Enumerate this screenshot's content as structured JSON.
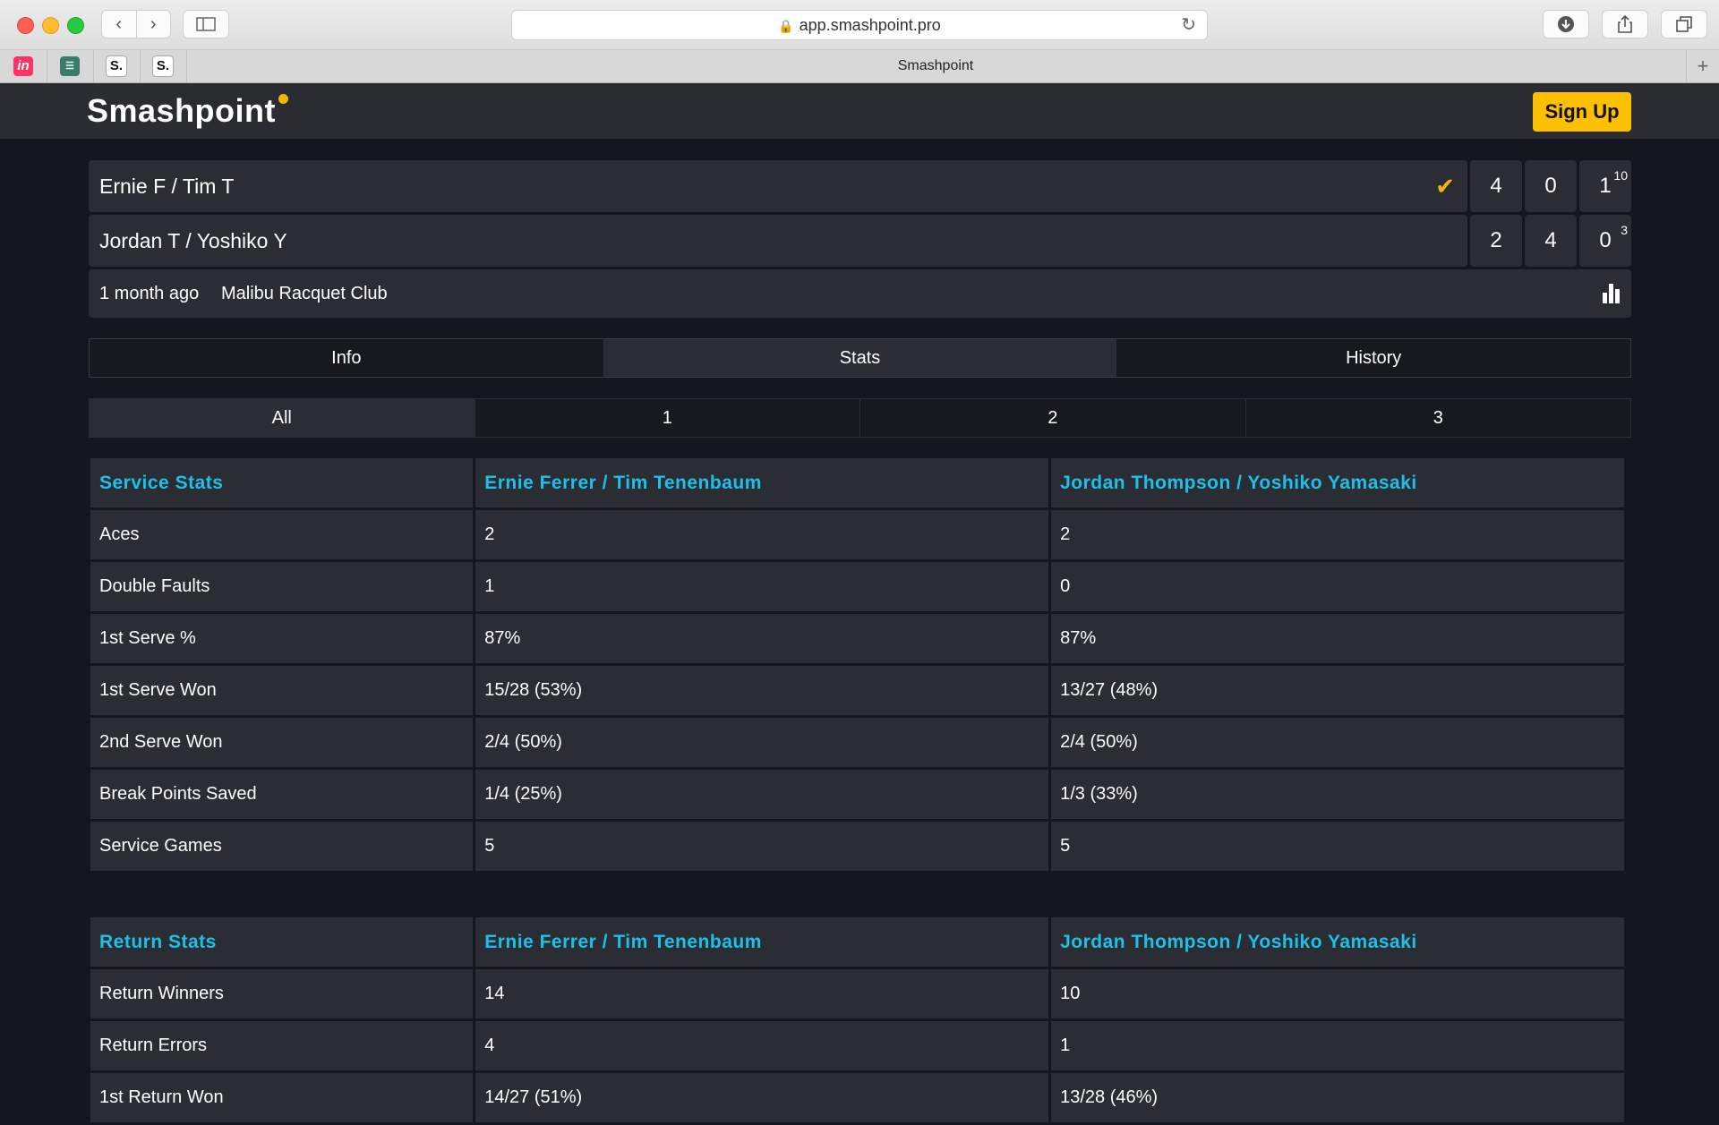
{
  "browser": {
    "url": "app.smashpoint.pro",
    "tab_title": "Smashpoint",
    "favicons": [
      "invision-icon",
      "bookmark-icon",
      "s-icon",
      "s-icon"
    ],
    "fav_letters": [
      "in",
      "",
      "S.",
      "S."
    ]
  },
  "header": {
    "logo": "Smashpoint",
    "signup_label": "Sign Up"
  },
  "match": {
    "team1": {
      "name": "Ernie F / Tim T",
      "winner": true,
      "sets": [
        "4",
        "0",
        "1"
      ],
      "tiebreak": "10"
    },
    "team2": {
      "name": "Jordan T / Yoshiko Y",
      "sets": [
        "2",
        "4",
        "0"
      ],
      "tiebreak": "3"
    },
    "time": "1 month ago",
    "venue": "Malibu Racquet Club"
  },
  "tabs": {
    "main": [
      "Info",
      "Stats",
      "History"
    ],
    "active_main": "Stats",
    "sets": [
      "All",
      "1",
      "2",
      "3"
    ],
    "active_set": "All"
  },
  "service_stats": {
    "headers": [
      "Service Stats",
      "Ernie Ferrer / Tim Tenenbaum",
      "Jordan Thompson / Yoshiko Yamasaki"
    ],
    "rows": [
      [
        "Aces",
        "2",
        "2"
      ],
      [
        "Double Faults",
        "1",
        "0"
      ],
      [
        "1st Serve %",
        "87%",
        "87%"
      ],
      [
        "1st Serve Won",
        "15/28 (53%)",
        "13/27 (48%)"
      ],
      [
        "2nd Serve Won",
        "2/4 (50%)",
        "2/4 (50%)"
      ],
      [
        "Break Points Saved",
        "1/4 (25%)",
        "1/3 (33%)"
      ],
      [
        "Service Games",
        "5",
        "5"
      ]
    ]
  },
  "return_stats": {
    "headers": [
      "Return Stats",
      "Ernie Ferrer / Tim Tenenbaum",
      "Jordan Thompson / Yoshiko Yamasaki"
    ],
    "rows": [
      [
        "Return Winners",
        "14",
        "10"
      ],
      [
        "Return Errors",
        "4",
        "1"
      ],
      [
        "1st Return Won",
        "14/27 (51%)",
        "13/28 (46%)"
      ]
    ]
  },
  "colors": {
    "accent": "#fcc000",
    "heading": "#1ec0e8",
    "card": "#2a2d33",
    "background": "#14171d"
  }
}
